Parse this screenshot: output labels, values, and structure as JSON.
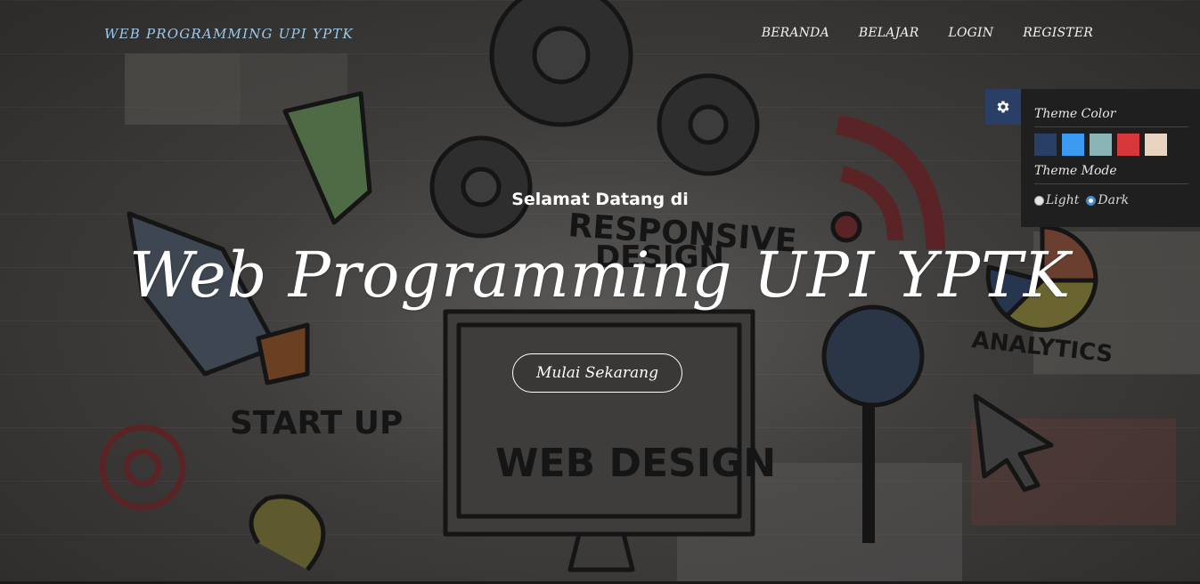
{
  "brand": "WEB PROGRAMMING UPI YPTK",
  "nav": {
    "items": [
      "BERANDA",
      "BELAJAR",
      "LOGIN",
      "REGISTER"
    ]
  },
  "hero": {
    "welcome": "Selamat Datang di",
    "title": "Web Programming UPI YPTK",
    "cta": "Mulai Sekarang"
  },
  "theme_panel": {
    "gear_icon": "gear-icon",
    "color_heading": "Theme Color",
    "colors": [
      "#2a3f66",
      "#3a9af0",
      "#8ab5b4",
      "#d6383c",
      "#e8d2c0"
    ],
    "mode_heading": "Theme Mode",
    "modes": [
      {
        "label": "Light",
        "selected": false
      },
      {
        "label": "Dark",
        "selected": true
      }
    ]
  },
  "background_sketch_labels": [
    "RESPONSIVE",
    "DESIGN",
    "ANALYTICS",
    "START UP",
    "WEB DESIGN",
    "@"
  ]
}
